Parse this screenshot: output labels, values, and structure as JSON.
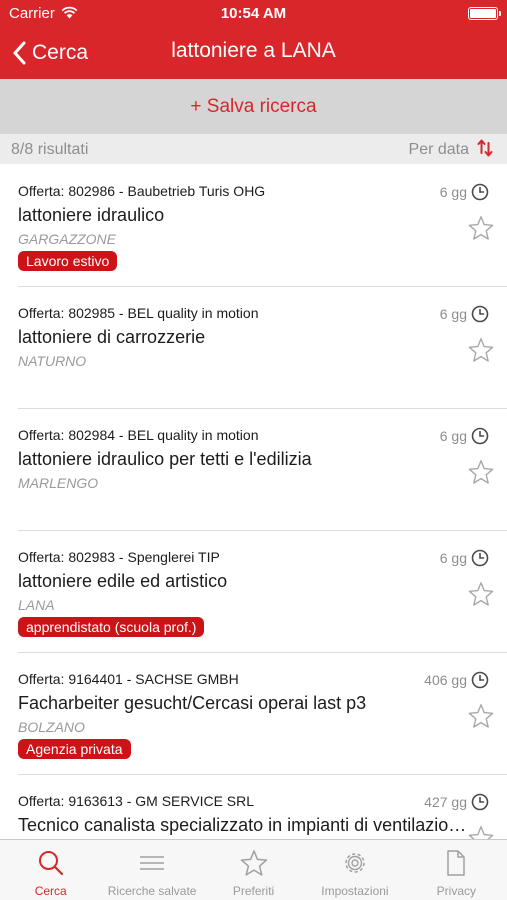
{
  "status_bar": {
    "carrier": "Carrier",
    "time": "10:54 AM",
    "battery_level": 1.0
  },
  "nav": {
    "back_label": "Cerca",
    "title": "lattoniere a LANA"
  },
  "save_search": {
    "label": "+ Salva ricerca"
  },
  "results": {
    "count": "8/8 risultati",
    "sort_label": "Per data"
  },
  "jobs": [
    {
      "offer": "Offerta: 802986 - Baubetrieb Turis OHG",
      "age": "6 gg",
      "title": "lattoniere idraulico",
      "city": "GARGAZZONE",
      "badge": "Lavoro estivo"
    },
    {
      "offer": "Offerta: 802985 - BEL quality in motion",
      "age": "6 gg",
      "title": "lattoniere di carrozzerie",
      "city": "NATURNO",
      "badge": ""
    },
    {
      "offer": "Offerta: 802984 - BEL quality in motion",
      "age": "6 gg",
      "title": "lattoniere idraulico per tetti e l'edilizia",
      "city": "MARLENGO",
      "badge": ""
    },
    {
      "offer": "Offerta: 802983 - Spenglerei TIP",
      "age": "6 gg",
      "title": "lattoniere edile ed artistico",
      "city": "LANA",
      "badge": "apprendistato (scuola prof.)"
    },
    {
      "offer": "Offerta: 9164401 - SACHSE GMBH",
      "age": "406 gg",
      "title": "Facharbeiter gesucht/Cercasi operai last p3",
      "city": "BOLZANO",
      "badge": "Agenzia privata"
    },
    {
      "offer": "Offerta: 9163613 - GM SERVICE SRL",
      "age": "427 gg",
      "title": "Tecnico canalista specializzato in impianti di ventilazione",
      "city": "",
      "badge": ""
    }
  ],
  "tabs": [
    {
      "label": "Cerca",
      "icon": "search-icon",
      "active": true
    },
    {
      "label": "Ricerche salvate",
      "icon": "list-icon",
      "active": false
    },
    {
      "label": "Preferiti",
      "icon": "star-icon",
      "active": false
    },
    {
      "label": "Impostazioni",
      "icon": "gear-icon",
      "active": false
    },
    {
      "label": "Privacy",
      "icon": "document-icon",
      "active": false
    }
  ],
  "colors": {
    "brand_red": "#d9262b",
    "badge_red": "#cc1418",
    "muted_gray": "#9a9a9a"
  }
}
